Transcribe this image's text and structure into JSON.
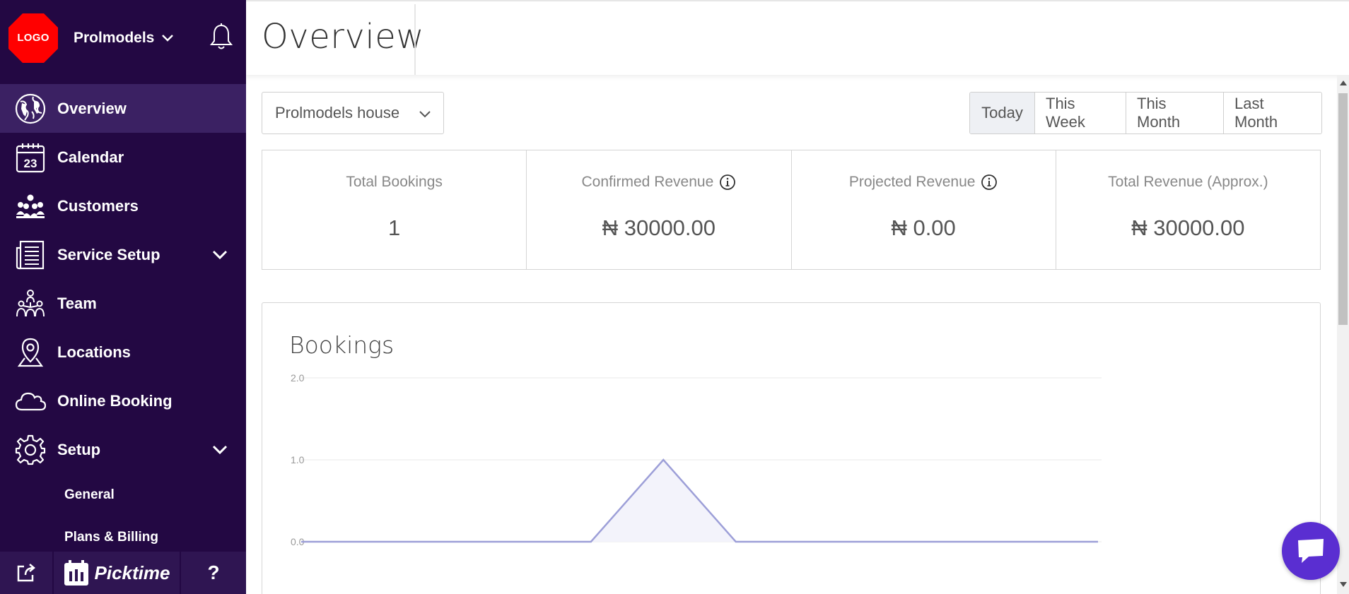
{
  "sidebar": {
    "logo_text": "LOGO",
    "account_name": "Prolmodels",
    "nav": [
      {
        "label": "Overview",
        "icon": "globe-icon",
        "active": true
      },
      {
        "label": "Calendar",
        "icon": "calendar-icon"
      },
      {
        "label": "Customers",
        "icon": "customers-icon"
      },
      {
        "label": "Service Setup",
        "icon": "service-setup-icon",
        "expandable": true
      },
      {
        "label": "Team",
        "icon": "team-icon"
      },
      {
        "label": "Locations",
        "icon": "location-pin-icon"
      },
      {
        "label": "Online Booking",
        "icon": "cloud-icon"
      },
      {
        "label": "Setup",
        "icon": "gear-icon",
        "expandable": true
      }
    ],
    "calendar_day": "23",
    "setup_sub": [
      "General",
      "Plans & Billing"
    ],
    "brand": "Picktime",
    "help": "?"
  },
  "header": {
    "title": "Overview"
  },
  "filters": {
    "location": "Prolmodels house",
    "periods": [
      "Today",
      "This Week",
      "This Month",
      "Last Month"
    ],
    "active_period": "Today"
  },
  "stats": [
    {
      "label": "Total Bookings",
      "value": "1",
      "info": false
    },
    {
      "label": "Confirmed Revenue",
      "value": "₦ 30000.00",
      "info": true
    },
    {
      "label": "Projected Revenue",
      "value": "₦ 0.00",
      "info": true
    },
    {
      "label": "Total Revenue (Approx.)",
      "value": "₦ 30000.00",
      "info": false
    }
  ],
  "colors": {
    "sidebar_bg": "#230843",
    "sidebar_active": "#3b2163",
    "logo_red": "#ff0000",
    "chart_line": "#9d9fd8",
    "chart_fill": "#f3f3fb",
    "chat_button": "#5a2ed1"
  },
  "chart_data": {
    "type": "area",
    "title": "Bookings",
    "yticks": [
      "2.0",
      "1.0",
      "0.0"
    ],
    "ylim": [
      0,
      2
    ],
    "x": [
      0,
      1,
      2,
      3,
      4,
      5,
      6,
      7,
      8,
      9,
      10,
      11
    ],
    "values": [
      0,
      0,
      0,
      0,
      0,
      1,
      0,
      0,
      0,
      0,
      0,
      0
    ],
    "grid": true
  }
}
